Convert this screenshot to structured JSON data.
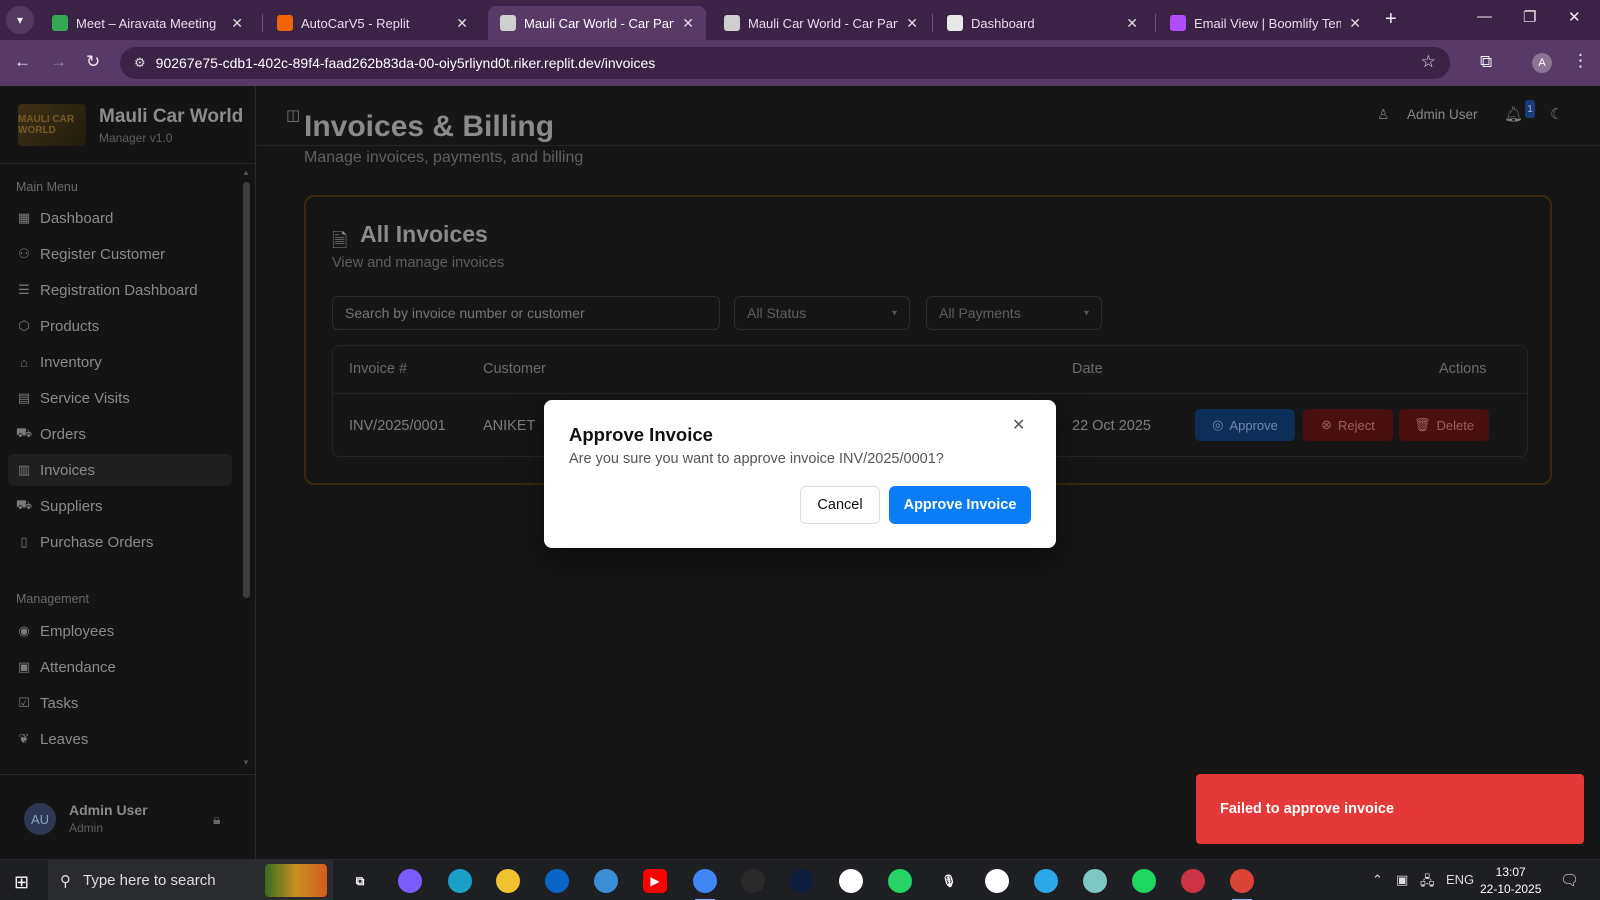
{
  "browser": {
    "tabs": [
      {
        "title": "Meet – Airavata Meeting",
        "icon": "google-meet-icon",
        "color": "#34a853"
      },
      {
        "title": "AutoCarV5 - Replit",
        "icon": "replit-icon",
        "color": "#f26207"
      },
      {
        "title": "Mauli Car World - Car Parts &",
        "icon": "globe-icon",
        "color": "#cfcfcf",
        "active": true
      },
      {
        "title": "Mauli Car World - Car Parts &",
        "icon": "globe-icon",
        "color": "#cfcfcf"
      },
      {
        "title": "Dashboard",
        "icon": "document-icon",
        "color": "#e8e8e8"
      },
      {
        "title": "Email View | Boomlify Tempo",
        "icon": "boomlify-icon",
        "color": "#b14cff"
      }
    ],
    "url": "90267e75-cdb1-402c-89f4-faad262b83da-00-oiy5rliynd0t.riker.replit.dev/invoices",
    "profile_initial": "A"
  },
  "sidebar": {
    "logo_text": "MAULI CAR WORLD",
    "brand_name": "Mauli Car World",
    "brand_version": "Manager v1.0",
    "main_menu_label": "Main Menu",
    "main_items": [
      {
        "label": "Dashboard",
        "icon": "grid-icon"
      },
      {
        "label": "Register Customer",
        "icon": "user-plus-icon"
      },
      {
        "label": "Registration Dashboard",
        "icon": "list-check-icon"
      },
      {
        "label": "Products",
        "icon": "package-icon"
      },
      {
        "label": "Inventory",
        "icon": "warehouse-icon"
      },
      {
        "label": "Service Visits",
        "icon": "clipboard-icon"
      },
      {
        "label": "Orders",
        "icon": "cart-icon"
      },
      {
        "label": "Invoices",
        "icon": "receipt-icon",
        "active": true
      },
      {
        "label": "Suppliers",
        "icon": "truck-icon"
      },
      {
        "label": "Purchase Orders",
        "icon": "file-icon"
      }
    ],
    "management_label": "Management",
    "management_items": [
      {
        "label": "Employees",
        "icon": "user-circle-icon"
      },
      {
        "label": "Attendance",
        "icon": "calendar-icon"
      },
      {
        "label": "Tasks",
        "icon": "checkbox-icon"
      },
      {
        "label": "Leaves",
        "icon": "leaf-icon"
      }
    ],
    "user": {
      "initials": "AU",
      "name": "Admin User",
      "role": "Admin"
    }
  },
  "topbar": {
    "user_name": "Admin User",
    "notification_count": "1"
  },
  "page": {
    "title": "Invoices & Billing",
    "subtitle": "Manage invoices, payments, and billing",
    "card_title": "All Invoices",
    "card_subtitle": "View and manage invoices",
    "search_placeholder": "Search by invoice number or customer",
    "status_filter": "All Status",
    "payment_filter": "All Payments",
    "columns": [
      "Invoice #",
      "Customer",
      "Date",
      "Actions"
    ],
    "row": {
      "invoice_no": "INV/2025/0001",
      "customer": "ANIKET",
      "date": "22 Oct 2025",
      "approve_label": "Approve",
      "reject_label": "Reject",
      "delete_label": "Delete"
    }
  },
  "modal": {
    "title": "Approve Invoice",
    "message": "Are you sure you want to approve invoice INV/2025/0001?",
    "cancel_label": "Cancel",
    "confirm_label": "Approve Invoice"
  },
  "toast": {
    "message": "Failed to approve invoice",
    "color": "#e53939"
  },
  "taskbar": {
    "search_placeholder": "Type here to search",
    "language": "ENG",
    "time": "13:07",
    "date": "22-10-2025"
  }
}
